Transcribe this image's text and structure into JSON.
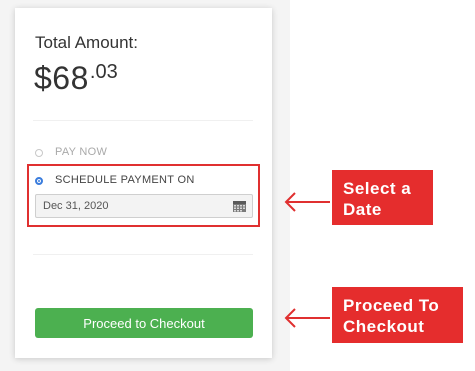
{
  "order": {
    "total_label": "Total Amount:",
    "amount_main": "$68",
    "amount_cents": ".03"
  },
  "payment": {
    "options": [
      {
        "label": "PAY NOW",
        "selected": false
      },
      {
        "label": "SCHEDULE PAYMENT ON",
        "selected": true
      }
    ],
    "date_value": "Dec 31, 2020",
    "date_icon": "calendar-icon"
  },
  "checkout_button": {
    "label": "Proceed to Checkout",
    "color": "#4cb050"
  },
  "callouts": [
    {
      "lines": [
        "Select a",
        "Date"
      ],
      "color": "#e52d2d"
    },
    {
      "lines": [
        "Proceed To",
        "Checkout"
      ],
      "color": "#e52d2d"
    }
  ]
}
